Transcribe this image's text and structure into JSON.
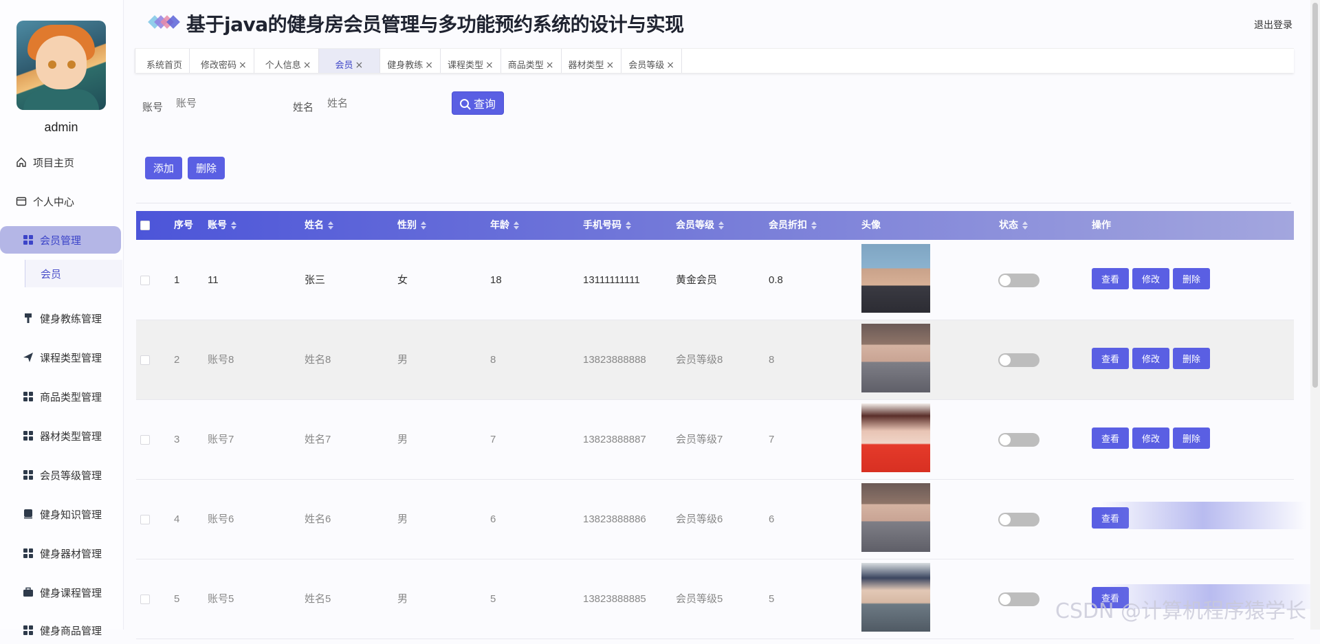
{
  "app": {
    "title": "基于java的健身房会员管理与多功能预约系统的设计与实现",
    "logout": "退出登录"
  },
  "sidebar": {
    "username": "admin",
    "items": [
      {
        "label": "项目主页",
        "icon": "home-icon"
      },
      {
        "label": "个人中心",
        "icon": "profile-card-icon"
      },
      {
        "label": "会员管理",
        "icon": "grid-icon",
        "active": true
      },
      {
        "label": "会员",
        "sub": true
      },
      {
        "label": "健身教练管理",
        "icon": "pin-icon"
      },
      {
        "label": "课程类型管理",
        "icon": "paper-plane-icon"
      },
      {
        "label": "商品类型管理",
        "icon": "grid-icon"
      },
      {
        "label": "器材类型管理",
        "icon": "grid-icon"
      },
      {
        "label": "会员等级管理",
        "icon": "grid-icon"
      },
      {
        "label": "健身知识管理",
        "icon": "book-icon"
      },
      {
        "label": "健身器材管理",
        "icon": "grid-icon"
      },
      {
        "label": "健身课程管理",
        "icon": "briefcase-icon"
      },
      {
        "label": "健身商品管理",
        "icon": "grid-icon"
      }
    ]
  },
  "tabs": [
    {
      "label": "系统首页",
      "closable": false
    },
    {
      "label": "修改密码",
      "closable": true
    },
    {
      "label": "个人信息",
      "closable": true
    },
    {
      "label": "会员",
      "closable": true,
      "active": true
    },
    {
      "label": "健身教练",
      "closable": true
    },
    {
      "label": "课程类型",
      "closable": true
    },
    {
      "label": "商品类型",
      "closable": true
    },
    {
      "label": "器材类型",
      "closable": true
    },
    {
      "label": "会员等级",
      "closable": true
    }
  ],
  "search": {
    "account_label": "账号",
    "account_placeholder": "账号",
    "name_label": "姓名",
    "name_placeholder": "姓名",
    "query_label": "查询"
  },
  "toolbar": {
    "add_label": "添加",
    "delete_label": "删除"
  },
  "table": {
    "headers": {
      "index": "序号",
      "account": "账号",
      "name": "姓名",
      "gender": "性别",
      "age": "年龄",
      "phone": "手机号码",
      "level": "会员等级",
      "discount": "会员折扣",
      "avatar": "头像",
      "status": "状态",
      "actions": "操作"
    },
    "rows": [
      {
        "index": "1",
        "account": "11",
        "name": "张三",
        "gender": "女",
        "age": "18",
        "phone": "13111111111",
        "level": "黄金会员",
        "discount": "0.8"
      },
      {
        "index": "2",
        "account": "账号8",
        "name": "姓名8",
        "gender": "男",
        "age": "8",
        "phone": "13823888888",
        "level": "会员等级8",
        "discount": "8"
      },
      {
        "index": "3",
        "account": "账号7",
        "name": "姓名7",
        "gender": "男",
        "age": "7",
        "phone": "13823888887",
        "level": "会员等级7",
        "discount": "7"
      },
      {
        "index": "4",
        "account": "账号6",
        "name": "姓名6",
        "gender": "男",
        "age": "6",
        "phone": "13823888886",
        "level": "会员等级6",
        "discount": "6"
      },
      {
        "index": "5",
        "account": "账号5",
        "name": "姓名5",
        "gender": "男",
        "age": "5",
        "phone": "13823888885",
        "level": "会员等级5",
        "discount": "5"
      }
    ],
    "actions": {
      "view": "查看",
      "edit": "修改",
      "delete": "删除",
      "view_truncated": "查看"
    }
  },
  "watermark": "CSDN @计算机程序猿学长",
  "colors": {
    "accent": "#5a5fe3",
    "active_nav": "#b4b6e6",
    "header_grad_start": "#4c55d9"
  }
}
